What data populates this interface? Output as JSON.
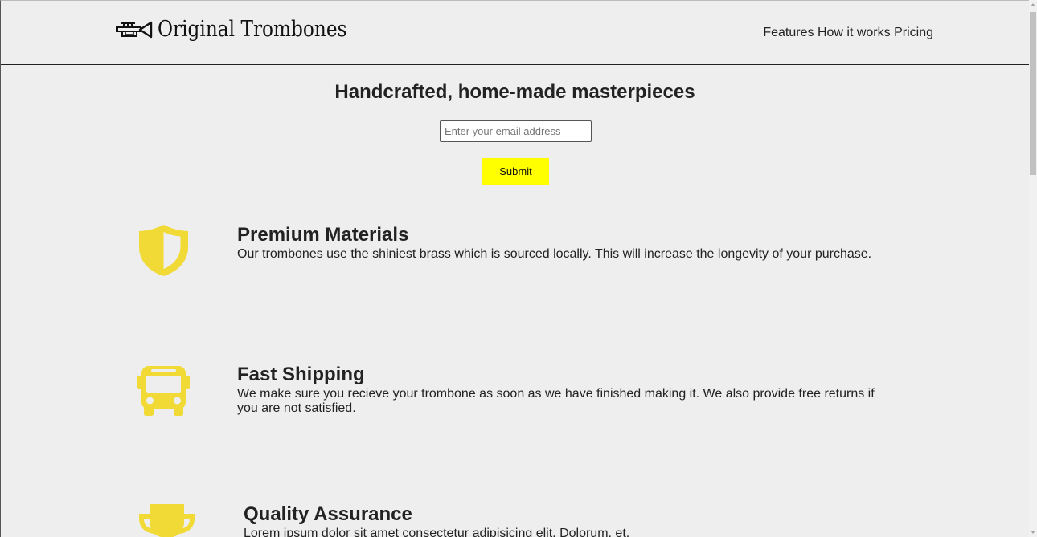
{
  "header": {
    "logo_icon": "trumpet-icon",
    "logo_text": "Original Trombones",
    "nav": {
      "features": "Features",
      "how_it_works": "How it works",
      "pricing": "Pricing"
    }
  },
  "hero": {
    "title": "Handcrafted, home-made masterpieces",
    "email_placeholder": "Enter your email address",
    "email_value": "",
    "submit_label": "Submit"
  },
  "features": [
    {
      "icon": "shield-icon",
      "title": "Premium Materials",
      "description": "Our trombones use the shiniest brass which is sourced locally. This will increase the longevity of your purchase."
    },
    {
      "icon": "bus-icon",
      "title": "Fast Shipping",
      "description": "We make sure you recieve your trombone as soon as we have finished making it. We also provide free returns if you are not satisfied."
    },
    {
      "icon": "trophy-icon",
      "title": "Quality Assurance",
      "description": "Lorem ipsum dolor sit amet consectetur adipisicing elit. Dolorum, et."
    }
  ],
  "colors": {
    "background": "#eeeeee",
    "accent_icon": "#f1da36",
    "submit_button": "#ffff00",
    "text": "#222222"
  }
}
